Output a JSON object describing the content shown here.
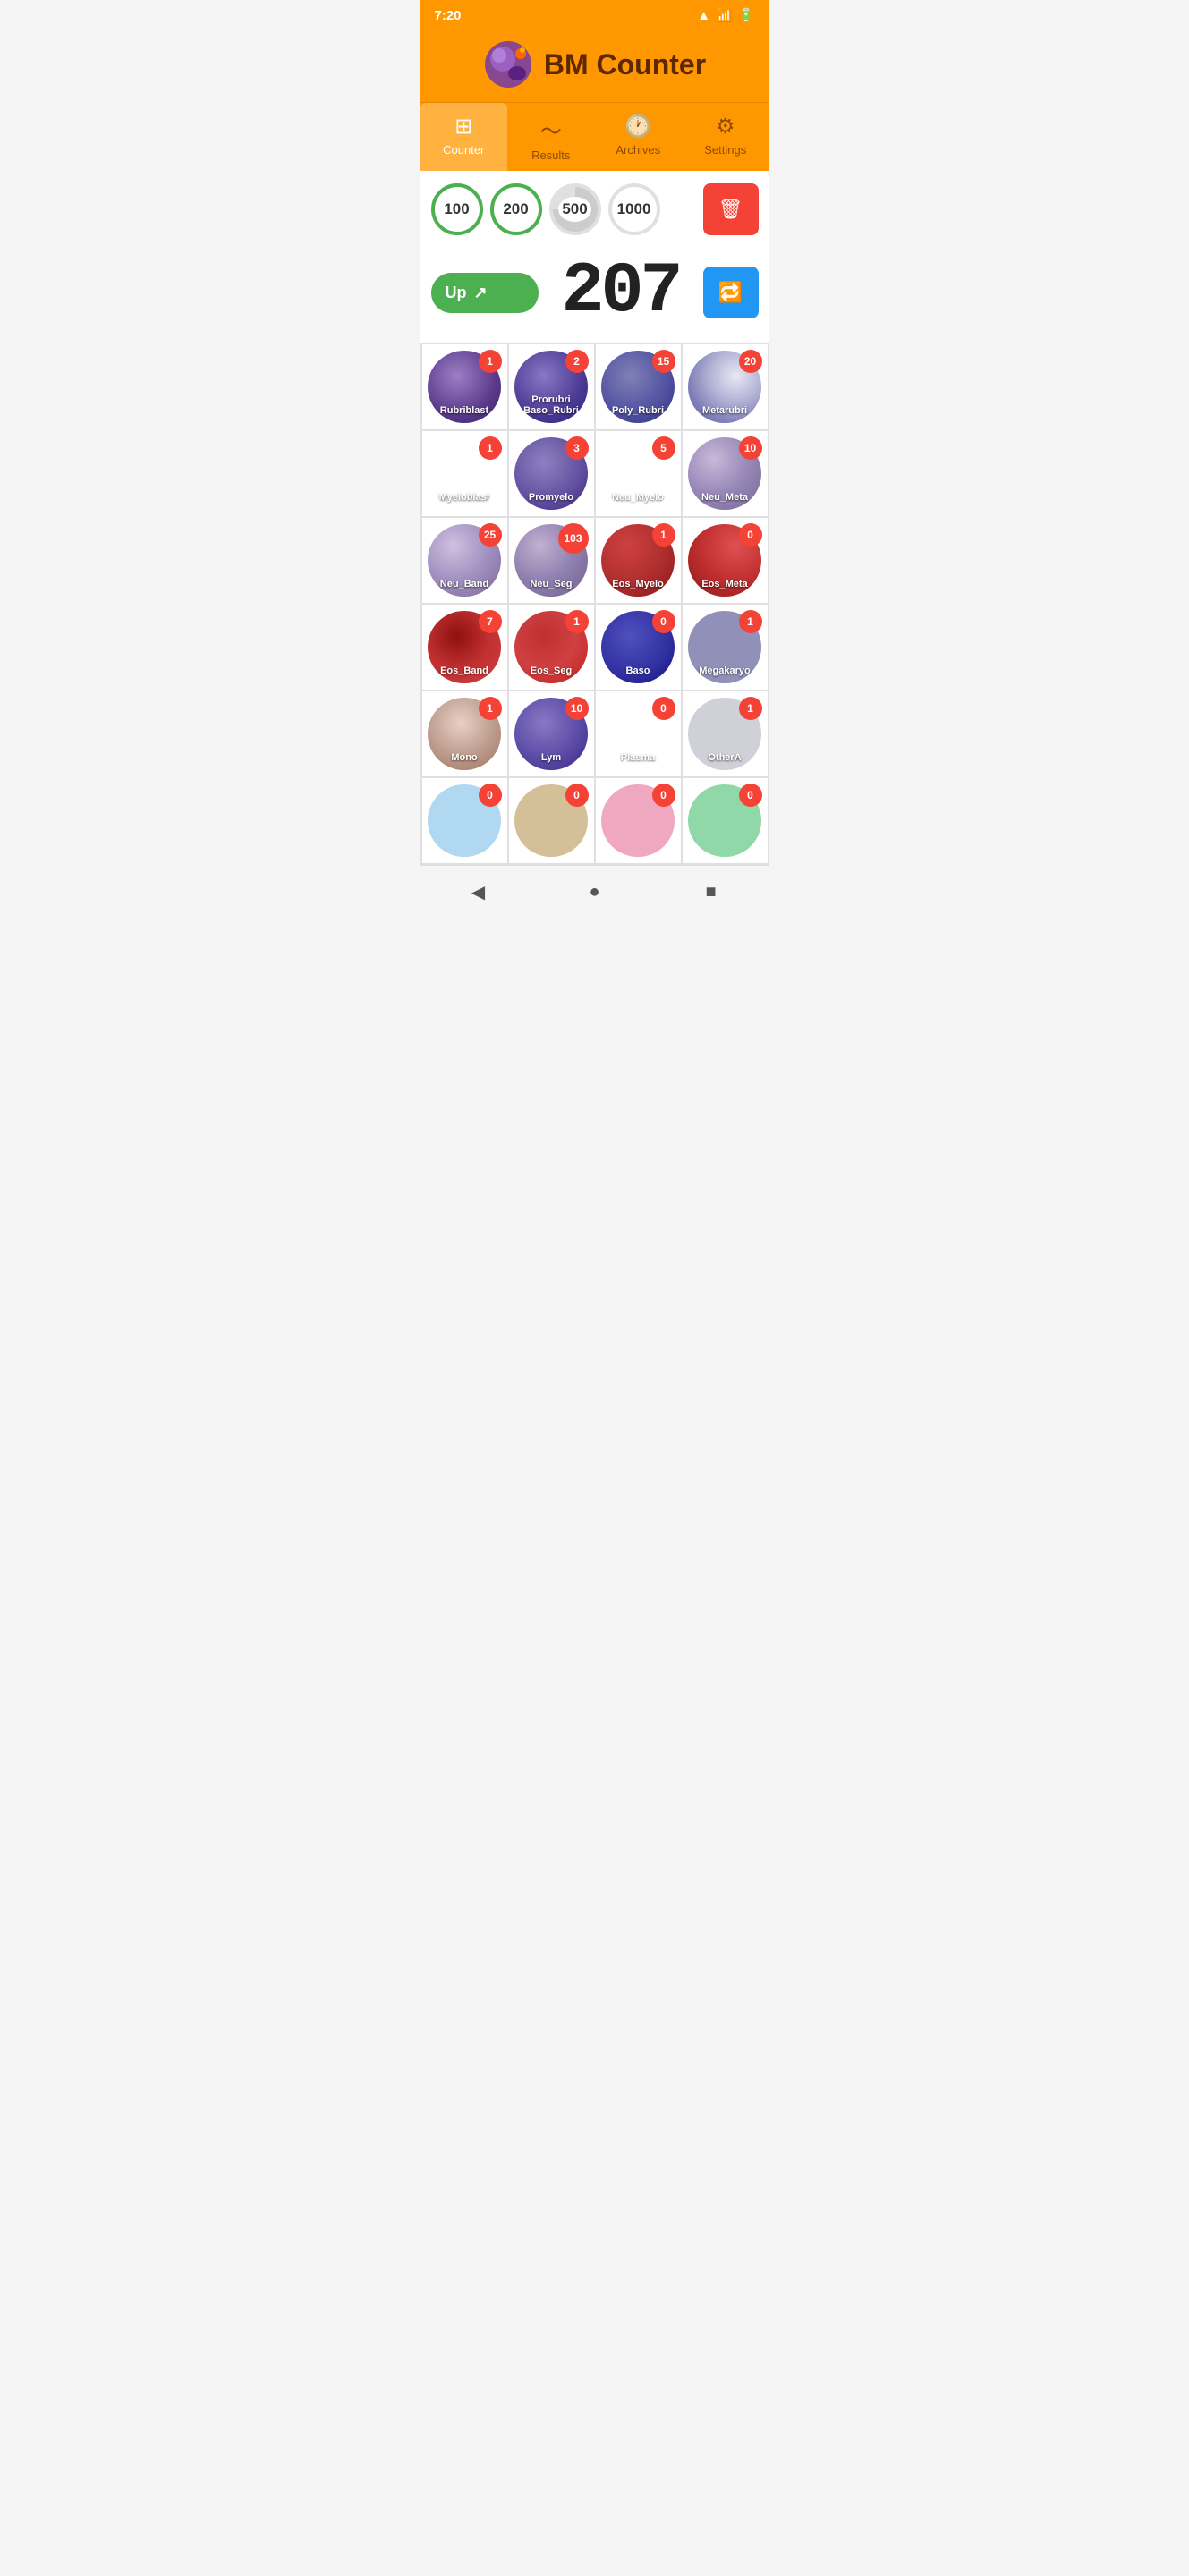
{
  "statusBar": {
    "time": "7:20",
    "icons": [
      "wifi",
      "signal",
      "battery"
    ]
  },
  "header": {
    "title": "BM Counter"
  },
  "tabs": [
    {
      "id": "counter",
      "label": "Counter",
      "icon": "⊞",
      "active": true
    },
    {
      "id": "results",
      "label": "Results",
      "icon": "📈",
      "active": false
    },
    {
      "id": "archives",
      "label": "Archives",
      "icon": "🕐",
      "active": false
    },
    {
      "id": "settings",
      "label": "Settings",
      "icon": "⚙",
      "active": false
    }
  ],
  "targets": [
    {
      "value": "100",
      "color": "green"
    },
    {
      "value": "200",
      "color": "green"
    },
    {
      "value": "500",
      "color": "partial"
    },
    {
      "value": "1000",
      "color": "empty"
    }
  ],
  "counter": {
    "value": "207",
    "upLabel": "Up",
    "upIcon": "↗"
  },
  "cells": [
    {
      "id": "rubriblast",
      "label": "Rubriblast",
      "count": 1,
      "colorClass": "c-rubriblast"
    },
    {
      "id": "prorubri-baso-rubri",
      "label": "Prorubri Baso_Rubri",
      "count": 2,
      "colorClass": "c-prorubri"
    },
    {
      "id": "poly-rubri",
      "label": "Poly_Rubri",
      "count": 15,
      "colorClass": "c-poly-rubri"
    },
    {
      "id": "metarubri",
      "label": "Metarubri",
      "count": 20,
      "colorClass": "c-metarubri"
    },
    {
      "id": "myeloblast",
      "label": "Myeloblast",
      "count": 1,
      "colorClass": "c-myeloblast"
    },
    {
      "id": "promyelo",
      "label": "Promyelo",
      "count": 3,
      "colorClass": "c-promyelo"
    },
    {
      "id": "neu-myelo",
      "label": "Neu_Myelo",
      "count": 5,
      "colorClass": "c-neu-myelo"
    },
    {
      "id": "neu-meta",
      "label": "Neu_Meta",
      "count": 10,
      "colorClass": "c-neu-meta"
    },
    {
      "id": "neu-band",
      "label": "Neu_Band",
      "count": 25,
      "colorClass": "c-neu-band"
    },
    {
      "id": "neu-seg",
      "label": "Neu_Seg",
      "count": 103,
      "colorClass": "c-neu-seg"
    },
    {
      "id": "eos-myelo",
      "label": "Eos_Myelo",
      "count": 1,
      "colorClass": "c-eos-myelo"
    },
    {
      "id": "eos-meta",
      "label": "Eos_Meta",
      "count": 0,
      "colorClass": "c-eos-meta"
    },
    {
      "id": "eos-band",
      "label": "Eos_Band",
      "count": 7,
      "colorClass": "c-eos-band"
    },
    {
      "id": "eos-seg",
      "label": "Eos_Seg",
      "count": 1,
      "colorClass": "c-eos-seg"
    },
    {
      "id": "baso",
      "label": "Baso",
      "count": 0,
      "colorClass": "c-baso"
    },
    {
      "id": "megakaryo",
      "label": "Megakaryo",
      "count": 1,
      "colorClass": "c-megakaryo"
    },
    {
      "id": "mono",
      "label": "Mono",
      "count": 1,
      "colorClass": "c-mono"
    },
    {
      "id": "lym",
      "label": "Lym",
      "count": 10,
      "colorClass": "c-lym"
    },
    {
      "id": "plasma",
      "label": "Plasma",
      "count": 0,
      "colorClass": "c-plasma"
    },
    {
      "id": "othera",
      "label": "OtherA",
      "count": 1,
      "colorClass": "c-othera"
    },
    {
      "id": "light-blue",
      "label": "",
      "count": 0,
      "colorClass": "c-light-blue"
    },
    {
      "id": "tan",
      "label": "",
      "count": 0,
      "colorClass": "c-tan"
    },
    {
      "id": "pink",
      "label": "",
      "count": 0,
      "colorClass": "c-pink"
    },
    {
      "id": "green",
      "label": "",
      "count": 0,
      "colorClass": "c-green"
    }
  ],
  "bottomNav": {
    "backLabel": "◀",
    "homeLabel": "●",
    "recentLabel": "■"
  }
}
